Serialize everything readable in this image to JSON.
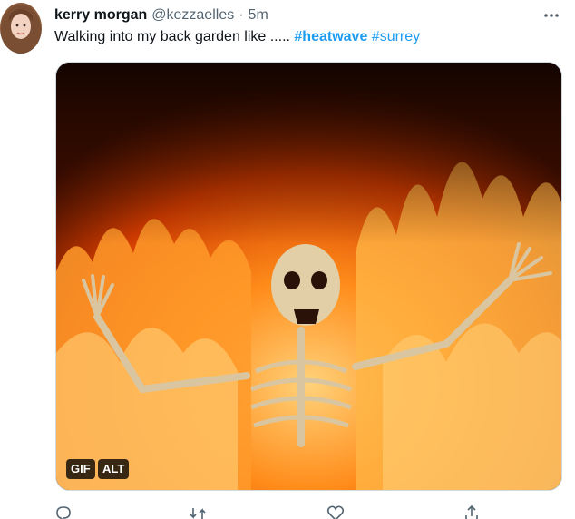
{
  "tweet": {
    "author": {
      "display_name": "kerry morgan",
      "handle": "@kezzaelles",
      "separator": "·",
      "time": "5m"
    },
    "more_icon": "more-horizontal-icon",
    "text": {
      "body": "Walking into my back garden like ..... ",
      "hashtag_1": "#heatwave",
      "hashtag_2": "#surrey"
    },
    "media": {
      "gif_label": "GIF",
      "alt_label": "ALT"
    },
    "actions": {
      "reply_icon": "reply-icon",
      "retweet_icon": "retweet-icon",
      "like_icon": "heart-icon",
      "share_icon": "share-icon"
    },
    "colors": {
      "link": "#1d9bf0",
      "text": "#0f1419",
      "secondary": "#536471"
    }
  }
}
